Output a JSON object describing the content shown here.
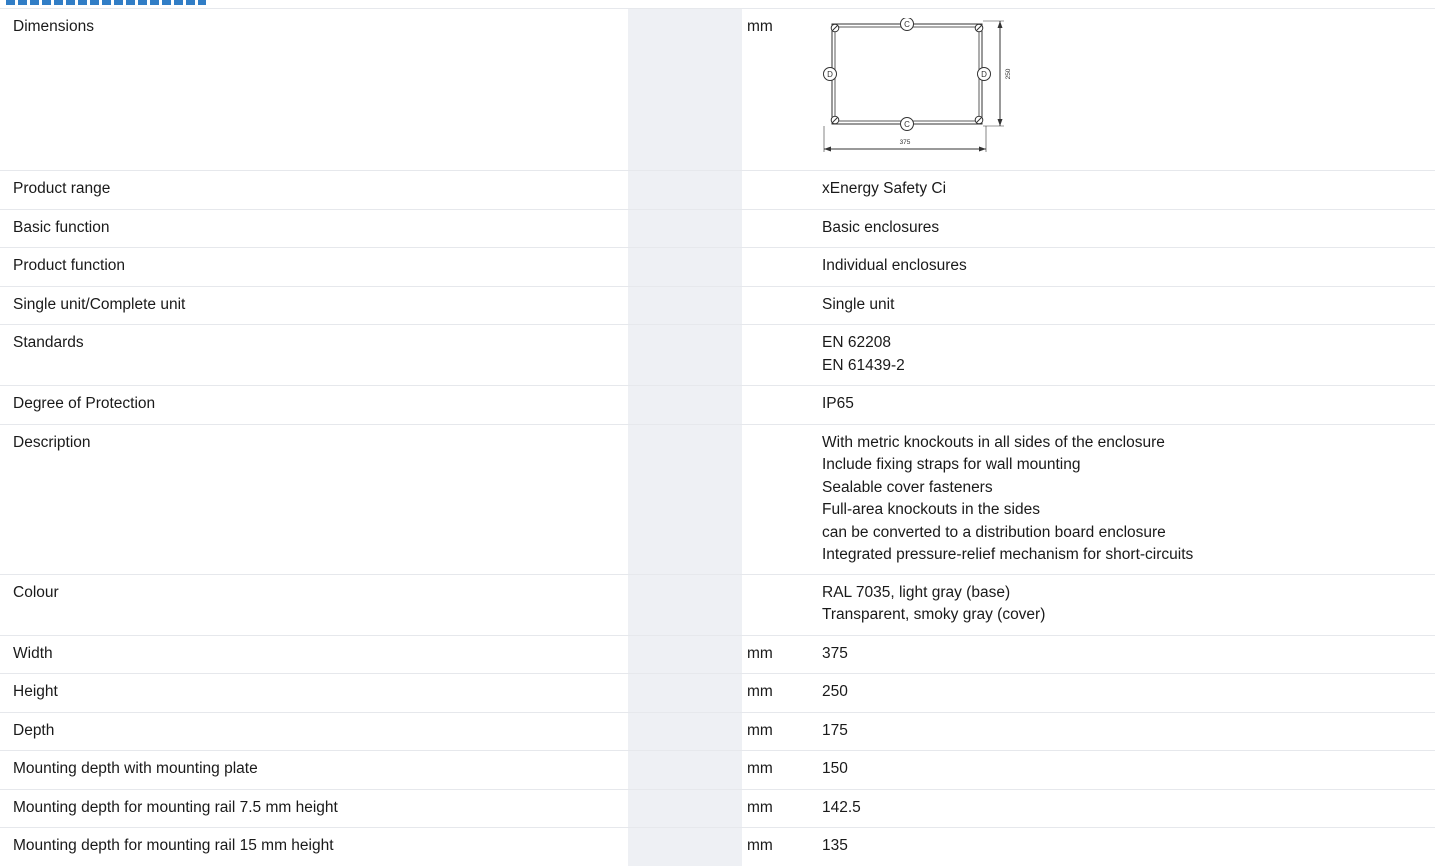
{
  "rows": [
    {
      "label": "Dimensions",
      "unit": "mm"
    },
    {
      "label": "Product range",
      "unit": "",
      "value": [
        "xEnergy Safety Ci"
      ]
    },
    {
      "label": "Basic function",
      "unit": "",
      "value": [
        "Basic enclosures"
      ]
    },
    {
      "label": "Product function",
      "unit": "",
      "value": [
        "Individual enclosures"
      ]
    },
    {
      "label": "Single unit/Complete unit",
      "unit": "",
      "value": [
        "Single unit"
      ]
    },
    {
      "label": "Standards",
      "unit": "",
      "value": [
        "EN 62208",
        "EN 61439-2"
      ]
    },
    {
      "label": "Degree of Protection",
      "unit": "",
      "value": [
        "IP65"
      ]
    },
    {
      "label": "Description",
      "unit": "",
      "value": [
        "With metric knockouts in all sides of the enclosure",
        "Include fixing straps for wall mounting",
        "Sealable cover fasteners",
        "Full-area knockouts in the sides",
        "can be converted to a distribution board enclosure",
        "Integrated pressure-relief mechanism for short-circuits"
      ]
    },
    {
      "label": "Colour",
      "unit": "",
      "value": [
        "RAL 7035, light gray (base)",
        "Transparent, smoky gray (cover)"
      ]
    },
    {
      "label": "Width",
      "unit": "mm",
      "value": [
        "375"
      ]
    },
    {
      "label": "Height",
      "unit": "mm",
      "value": [
        "250"
      ]
    },
    {
      "label": "Depth",
      "unit": "mm",
      "value": [
        "175"
      ]
    },
    {
      "label": "Mounting depth with mounting plate",
      "unit": "mm",
      "value": [
        "150"
      ]
    },
    {
      "label": "Mounting depth for mounting rail 7.5 mm height",
      "unit": "mm",
      "value": [
        "142.5"
      ]
    },
    {
      "label": "Mounting depth for mounting rail 15 mm height",
      "unit": "mm",
      "value": [
        "135"
      ]
    }
  ],
  "diagram": {
    "width_label": "375",
    "height_label": "250",
    "marker_c": "C",
    "marker_d": "D"
  },
  "colors": {
    "shade_column": "#eef0f4",
    "row_divider": "#e6e8ec",
    "heading_accent": "#1a6fc0"
  }
}
